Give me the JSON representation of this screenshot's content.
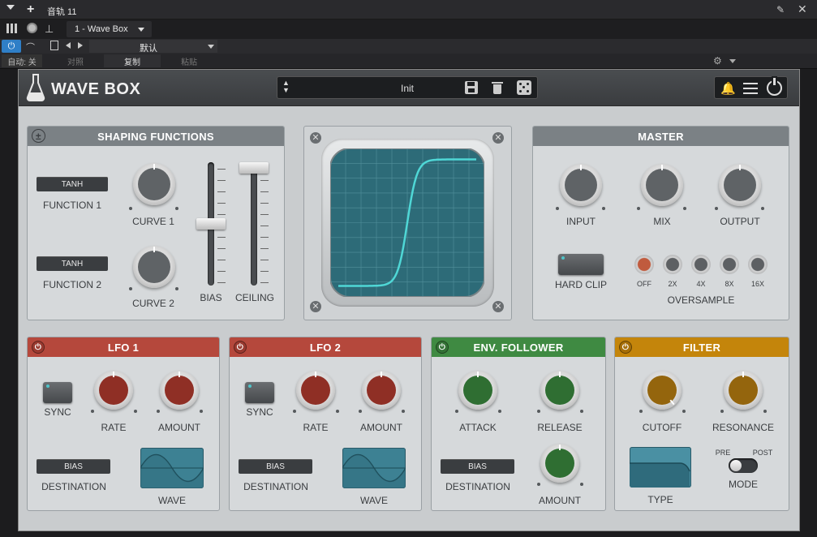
{
  "host": {
    "track_name": "音轨 11",
    "plugin_slot": "1 - Wave Box",
    "preset_default": "默认",
    "auto_label": "自动: 关",
    "compare_label": "对照",
    "copy_label": "复制",
    "paste_label": "粘贴"
  },
  "plugin": {
    "name": "WAVE BOX",
    "preset_name": "Init"
  },
  "shaping": {
    "title": "SHAPING FUNCTIONS",
    "function1_value": "TANH",
    "function1_label": "FUNCTION 1",
    "function2_value": "TANH",
    "function2_label": "FUNCTION 2",
    "curve1_label": "CURVE 1",
    "curve2_label": "CURVE 2",
    "bias_label": "BIAS",
    "ceiling_label": "CEILING",
    "bias_level": 0.5,
    "ceiling_level": 1.0
  },
  "master": {
    "title": "MASTER",
    "input_label": "INPUT",
    "mix_label": "MIX",
    "output_label": "OUTPUT",
    "hard_clip_label": "HARD CLIP",
    "oversample_label": "OVERSAMPLE",
    "oversample_options": [
      "OFF",
      "2X",
      "4X",
      "8X",
      "16X"
    ],
    "oversample_selected": "OFF"
  },
  "lfo1": {
    "title": "LFO 1",
    "sync_label": "SYNC",
    "rate_label": "RATE",
    "amount_label": "AMOUNT",
    "destination_value": "BIAS",
    "destination_label": "DESTINATION",
    "wave_label": "WAVE"
  },
  "lfo2": {
    "title": "LFO 2",
    "sync_label": "SYNC",
    "rate_label": "RATE",
    "amount_label": "AMOUNT",
    "destination_value": "BIAS",
    "destination_label": "DESTINATION",
    "wave_label": "WAVE"
  },
  "env": {
    "title": "ENV. FOLLOWER",
    "attack_label": "ATTACK",
    "release_label": "RELEASE",
    "amount_label": "AMOUNT",
    "destination_value": "BIAS",
    "destination_label": "DESTINATION"
  },
  "filter": {
    "title": "FILTER",
    "cutoff_label": "CUTOFF",
    "resonance_label": "RESONANCE",
    "type_label": "TYPE",
    "pre_label": "PRE",
    "post_label": "POST",
    "mode_label": "MODE"
  },
  "colors": {
    "lfo": "#b5483c",
    "env": "#3f8a42",
    "filter": "#c4850b",
    "teal": "#4fd7d6"
  }
}
